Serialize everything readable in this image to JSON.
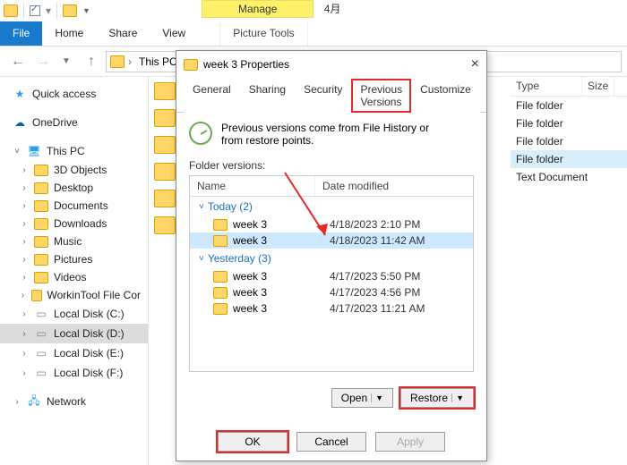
{
  "titlebar": {
    "context_group_label": "Manage",
    "context_group_name": "4月"
  },
  "ribbon": {
    "file": "File",
    "home": "Home",
    "share": "Share",
    "view": "View",
    "picture_tools": "Picture Tools"
  },
  "addressbar": {
    "crumb1": "This PC",
    "sep": "›"
  },
  "navpane": {
    "quick_access": "Quick access",
    "onedrive": "OneDrive",
    "this_pc": "This PC",
    "items": [
      "3D Objects",
      "Desktop",
      "Documents",
      "Downloads",
      "Music",
      "Pictures",
      "Videos",
      "WorkinTool File Cor",
      "Local Disk (C:)",
      "Local Disk (D:)",
      "Local Disk (E:)",
      "Local Disk (F:)"
    ],
    "network": "Network"
  },
  "rightcols": {
    "type": "Type",
    "size": "Size"
  },
  "rightlist": [
    "File folder",
    "File folder",
    "File folder",
    "File folder",
    "Text Document"
  ],
  "dialog": {
    "title": "week 3 Properties",
    "tabs": {
      "general": "General",
      "sharing": "Sharing",
      "security": "Security",
      "previous": "Previous Versions",
      "customize": "Customize"
    },
    "hint": "Previous versions come from File History or from restore points.",
    "list_label": "Folder versions:",
    "columns": {
      "name": "Name",
      "date": "Date modified"
    },
    "groups": [
      {
        "label": "Today (2)",
        "rows": [
          {
            "name": "week 3",
            "date": "4/18/2023 2:10 PM",
            "selected": false
          },
          {
            "name": "week 3",
            "date": "4/18/2023 11:42 AM",
            "selected": true
          }
        ]
      },
      {
        "label": "Yesterday (3)",
        "rows": [
          {
            "name": "week 3",
            "date": "4/17/2023 5:50 PM"
          },
          {
            "name": "week 3",
            "date": "4/17/2023 4:56 PM"
          },
          {
            "name": "week 3",
            "date": "4/17/2023 11:21 AM"
          }
        ]
      }
    ],
    "buttons": {
      "open": "Open",
      "restore": "Restore",
      "ok": "OK",
      "cancel": "Cancel",
      "apply": "Apply"
    }
  }
}
